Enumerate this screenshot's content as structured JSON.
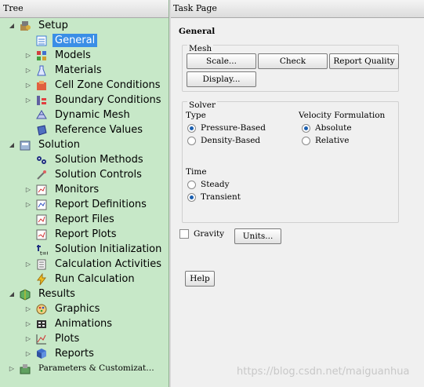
{
  "tree": {
    "title": "Tree",
    "items": [
      {
        "label": "Setup",
        "expander": "◢",
        "icon": "setup-icon"
      },
      {
        "label": "General",
        "expander": "",
        "icon": "general-icon",
        "selected": true
      },
      {
        "label": "Models",
        "expander": "▷",
        "icon": "models-icon"
      },
      {
        "label": "Materials",
        "expander": "▷",
        "icon": "materials-icon"
      },
      {
        "label": "Cell Zone Conditions",
        "expander": "▷",
        "icon": "cell-zone-icon"
      },
      {
        "label": "Boundary Conditions",
        "expander": "▷",
        "icon": "boundary-icon"
      },
      {
        "label": "Dynamic Mesh",
        "expander": "",
        "icon": "dynamic-mesh-icon"
      },
      {
        "label": "Reference Values",
        "expander": "",
        "icon": "reference-values-icon"
      },
      {
        "label": "Solution",
        "expander": "◢",
        "icon": "solution-icon"
      },
      {
        "label": "Solution Methods",
        "expander": "",
        "icon": "solution-methods-icon"
      },
      {
        "label": "Solution Controls",
        "expander": "",
        "icon": "solution-controls-icon"
      },
      {
        "label": "Monitors",
        "expander": "▷",
        "icon": "monitors-icon"
      },
      {
        "label": "Report Definitions",
        "expander": "▷",
        "icon": "report-definitions-icon"
      },
      {
        "label": "Report Files",
        "expander": "",
        "icon": "report-files-icon"
      },
      {
        "label": "Report Plots",
        "expander": "",
        "icon": "report-plots-icon"
      },
      {
        "label": "Solution Initialization",
        "expander": "",
        "icon": "initialization-icon"
      },
      {
        "label": "Calculation Activities",
        "expander": "▷",
        "icon": "calculation-activities-icon"
      },
      {
        "label": "Run Calculation",
        "expander": "",
        "icon": "run-calculation-icon"
      },
      {
        "label": "Results",
        "expander": "◢",
        "icon": "results-icon"
      },
      {
        "label": "Graphics",
        "expander": "▷",
        "icon": "graphics-icon"
      },
      {
        "label": "Animations",
        "expander": "▷",
        "icon": "animations-icon"
      },
      {
        "label": "Plots",
        "expander": "▷",
        "icon": "plots-icon"
      },
      {
        "label": "Reports",
        "expander": "▷",
        "icon": "reports-icon"
      },
      {
        "label": "Parameters & Customizat…",
        "expander": "▷",
        "icon": "parameters-icon"
      }
    ]
  },
  "task": {
    "header": "Task Page",
    "title": "General",
    "mesh": {
      "title": "Mesh",
      "scale_label": "Scale...",
      "check_label": "Check",
      "report_quality_label": "Report Quality",
      "display_label": "Display..."
    },
    "solver": {
      "title": "Solver",
      "type_label": "Type",
      "type_options": [
        "Pressure-Based",
        "Density-Based"
      ],
      "type_selected": "Pressure-Based",
      "velocity_label": "Velocity Formulation",
      "velocity_options": [
        "Absolute",
        "Relative"
      ],
      "velocity_selected": "Absolute",
      "time_label": "Time",
      "time_options": [
        "Steady",
        "Transient"
      ],
      "time_selected": "Transient"
    },
    "gravity_label": "Gravity",
    "gravity_checked": false,
    "units_label": "Units...",
    "help_label": "Help"
  },
  "watermark": "https://blog.csdn.net/maiguanhua"
}
